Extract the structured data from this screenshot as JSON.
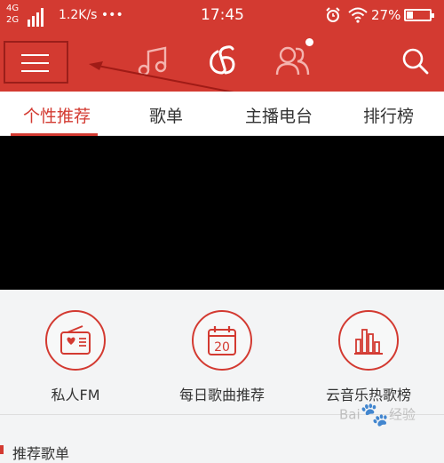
{
  "status_bar": {
    "network_top": "4G",
    "network_bottom": "2G",
    "speed": "1.2K/s",
    "more": "•••",
    "time": "17:45",
    "battery_pct": "27%",
    "battery_level": 0.27,
    "icons": [
      "signal-icon",
      "alarm-icon",
      "wifi-icon",
      "battery-icon"
    ]
  },
  "nav": {
    "icons": [
      "menu-icon",
      "music-note-icon",
      "netease-logo-icon",
      "friends-icon",
      "search-icon"
    ],
    "friends_badge": true
  },
  "tabs": [
    {
      "label": "个性推荐",
      "active": true
    },
    {
      "label": "歌单",
      "active": false
    },
    {
      "label": "主播电台",
      "active": false
    },
    {
      "label": "排行榜",
      "active": false
    }
  ],
  "features": [
    {
      "label": "私人FM",
      "icon": "radio-icon"
    },
    {
      "label": "每日歌曲推荐",
      "icon": "calendar-icon",
      "icon_text": "20"
    },
    {
      "label": "云音乐热歌榜",
      "icon": "chart-bars-icon"
    }
  ],
  "section": {
    "title": "推荐歌单"
  },
  "watermark": {
    "text": "经验",
    "brand": "Bai"
  },
  "colors": {
    "brand_red": "#d33a31",
    "annotation_red": "#9b1e1a"
  }
}
